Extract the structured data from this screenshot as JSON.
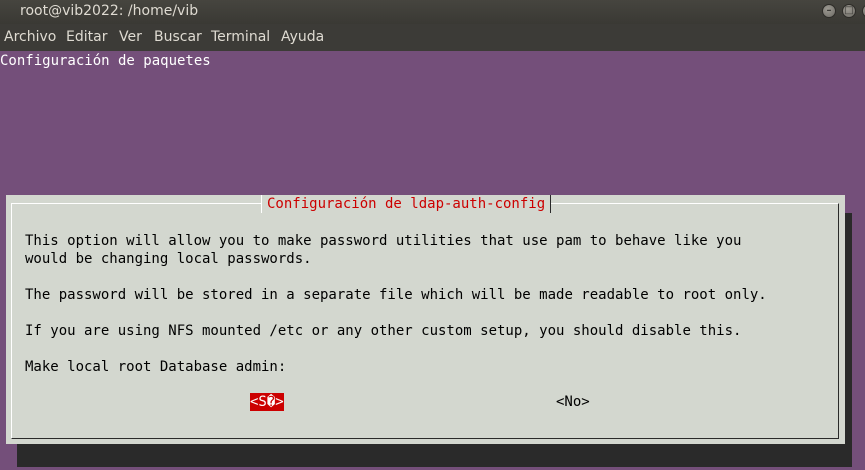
{
  "window": {
    "title": "root@vib2022: /home/vib",
    "buttons": {
      "minimize": "–",
      "maximize": "□",
      "close": "×"
    }
  },
  "menu": [
    "Archivo",
    "Editar",
    "Ver",
    "Buscar",
    "Terminal",
    "Ayuda"
  ],
  "terminal": {
    "heading": "Configuración de paquetes",
    "background": "#744f7a"
  },
  "dialog": {
    "title": "Configuración de ldap-auth-config",
    "lines": [
      "This option will allow you to make password utilities that use pam to behave like you",
      "would be changing local passwords.",
      "The password will be stored in a separate file which will be made readable to root only.",
      "If you are using NFS mounted /etc or any other custom setup, you should disable this.",
      "Make local root Database admin:"
    ],
    "yes_label": "<S�>",
    "no_label": "<No>",
    "accent": "#cc0000"
  }
}
